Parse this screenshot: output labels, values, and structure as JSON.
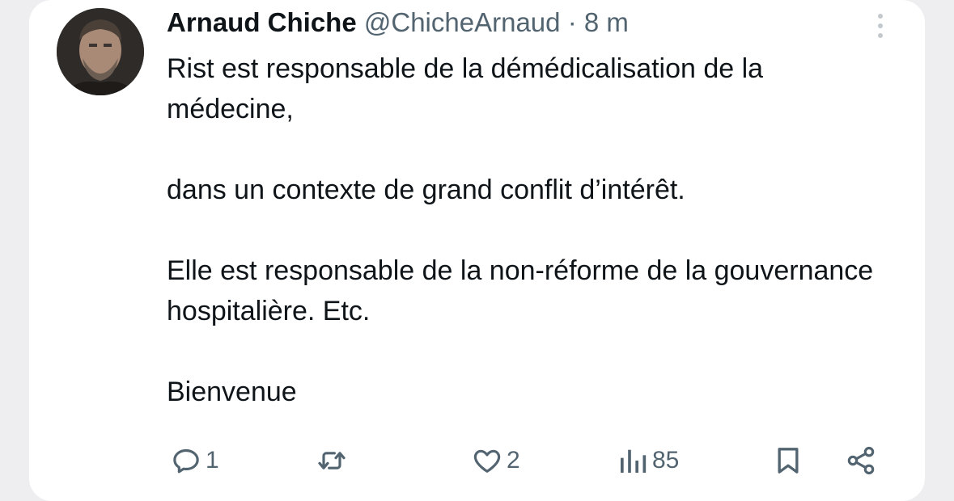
{
  "tweet": {
    "author_name": "Arnaud Chiche",
    "handle": "@ChicheArnaud",
    "separator": "·",
    "time": "8 m",
    "lines": [
      "Rist est responsable de la démédicalisation de la médecine,",
      "dans un contexte de grand conflit d’intérêt.",
      "Elle est responsable de la non-réforme de la gouvernance hospitalière. Etc.",
      "Bienvenue"
    ],
    "icons": {
      "avatar": "profile-photo",
      "more": "more-vertical-icon"
    }
  },
  "actions": {
    "reply": {
      "icon": "reply-icon",
      "count": "1"
    },
    "retweet": {
      "icon": "retweet-icon",
      "count": ""
    },
    "like": {
      "icon": "heart-icon",
      "count": "2"
    },
    "views": {
      "icon": "views-icon",
      "count": "85"
    },
    "bookmark": {
      "icon": "bookmark-icon"
    },
    "share": {
      "icon": "share-icon"
    }
  },
  "colors": {
    "text": "#0f1419",
    "secondary": "#536471",
    "background": "#ffffff",
    "outer": "#eeeef0"
  }
}
